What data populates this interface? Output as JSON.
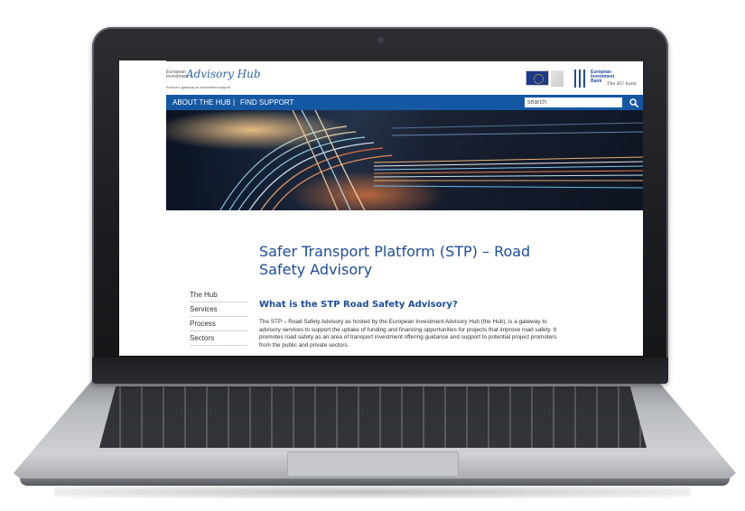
{
  "header": {
    "logo_small_line1": "European",
    "logo_small_line2": "Investment",
    "logo_script": "Advisory Hub",
    "logo_tagline": "Europe's gateway to investment support",
    "eib_line1": "European",
    "eib_line2": "Investment",
    "eib_line3": "Bank",
    "eib_script": "The EU bank"
  },
  "nav": {
    "about": "ABOUT THE HUB",
    "separator": "|",
    "find_support": "FIND SUPPORT",
    "search_placeholder": "search"
  },
  "page": {
    "title": "Safer Transport Platform (STP) – Road Safety Advisory",
    "section_heading": "What is the STP Road Safety Advisory?",
    "body": "The STP – Road Safety Advisory as hosted by the European Investment Advisory Hub (the Hub), is a gateway to advisory services to support the uptake of funding and financing opportunities for projects that improve road safety. It promotes road safety as an area of transport investment offering guidance and support to potential project promoters from the public and private sectors."
  },
  "side_nav": {
    "items": [
      {
        "label": "The Hub"
      },
      {
        "label": "Services"
      },
      {
        "label": "Process"
      },
      {
        "label": "Sectors"
      }
    ]
  },
  "colors": {
    "nav_blue": "#1458a3",
    "title_blue": "#1d4c9c",
    "laptop_frame": "#1b1c1f",
    "laptop_base": "#b9bcc0"
  },
  "icons": {
    "search": "search-icon",
    "eu_flag": "eu-flag-icon",
    "eib_logo": "eib-logo-icon",
    "camera": "camera-icon"
  }
}
